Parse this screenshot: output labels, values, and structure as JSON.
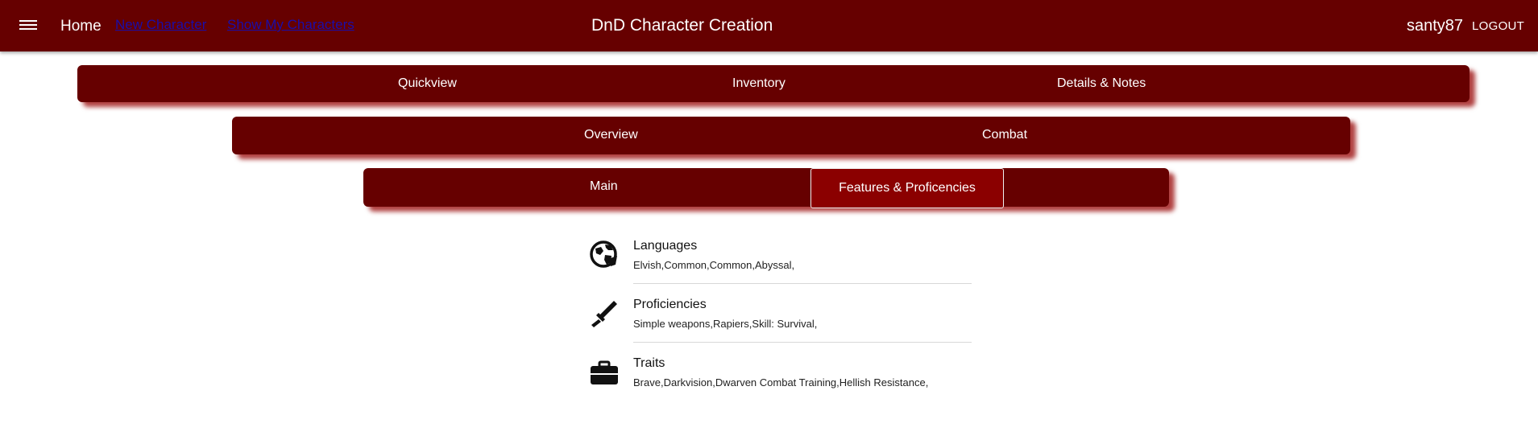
{
  "appbar": {
    "home": "Home",
    "new_character": "New Character",
    "show_characters": "Show My Characters",
    "title": "DnD Character Creation",
    "username": "santy87",
    "logout": "LOGOUT"
  },
  "tabs_level1": [
    "Quickview",
    "Inventory",
    "Details & Notes"
  ],
  "tabs_level2": [
    "Overview",
    "Combat"
  ],
  "tabs_level3": [
    "Main",
    "Features & Proficencies"
  ],
  "active_tab_level3": "Features & Proficencies",
  "features": [
    {
      "title": "Languages",
      "value": "Elvish,Common,Common,Abyssal,",
      "icon": "globe-icon"
    },
    {
      "title": "Proficiencies",
      "value": "Simple weapons,Rapiers,Skill: Survival,",
      "icon": "sword-icon"
    },
    {
      "title": "Traits",
      "value": "Brave,Darkvision,Dwarven Combat Training,Hellish Resistance,",
      "icon": "toolbox-icon"
    }
  ],
  "colors": {
    "primary": "#660000",
    "active_tab": "#8b0000",
    "link": "#1a0dab"
  }
}
